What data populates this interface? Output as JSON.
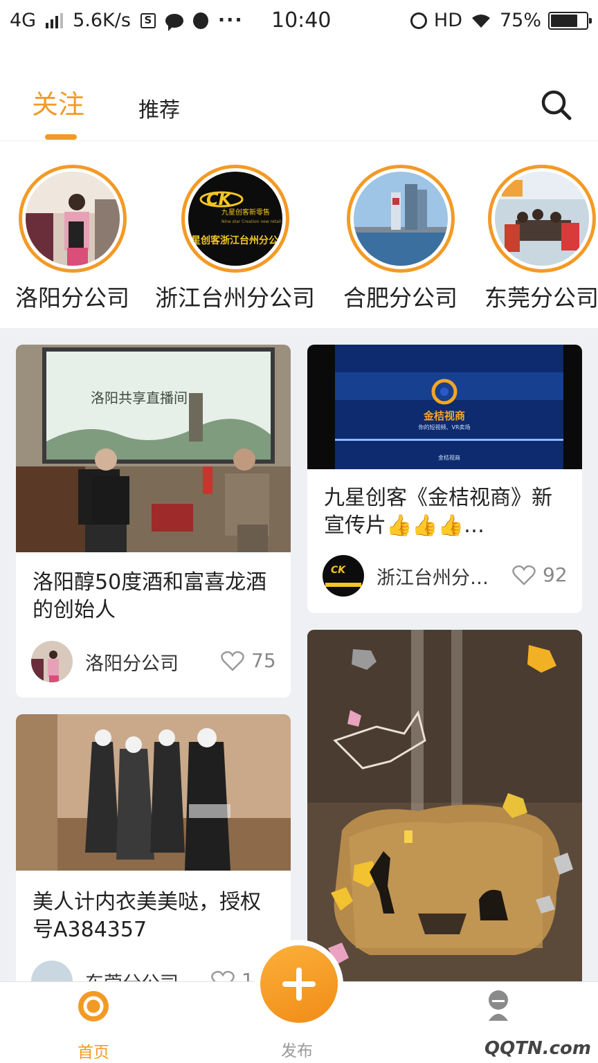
{
  "status_bar": {
    "network": "4G",
    "speed": "5.6K/s",
    "time": "10:40",
    "hd": "HD",
    "battery": "75%",
    "battery_level": 0.75,
    "icons": [
      "signal-icon",
      "sim-icon",
      "chat-icon",
      "flame-icon",
      "more-icon",
      "alarm-icon",
      "wifi-icon",
      "battery-icon"
    ]
  },
  "header": {
    "tabs": [
      {
        "label": "关注",
        "active": true
      },
      {
        "label": "推荐",
        "active": false
      }
    ],
    "search_icon": "search-icon",
    "accent_color": "#f39a26"
  },
  "follows": [
    {
      "name": "洛阳分公司",
      "avatar": "luoyang-avatar"
    },
    {
      "name": "浙江台州分公司",
      "avatar": "ck-logo-avatar"
    },
    {
      "name": "合肥分公司",
      "avatar": "hefei-avatar"
    },
    {
      "name": "东莞分公司",
      "avatar": "dongguan-avatar"
    }
  ],
  "feed": {
    "cards": [
      {
        "title": "洛阳醇50度酒和富喜龙酒的创始人",
        "author": "洛阳分公司",
        "likes": "75"
      },
      {
        "title": "九星创客《金桔视商》新宣传片👍👍👍…",
        "author": "浙江台州分…",
        "likes": "92"
      },
      {
        "title": "美人计内衣美美哒，授权号A384357",
        "author": "东莞分公司",
        "likes": "1"
      },
      {
        "title": "",
        "author": "",
        "likes": ""
      }
    ],
    "media_text": {
      "banner_text": "洛阳共享直播间",
      "logo_text": "金桔视商",
      "logo_sub": "你的短视频、VR卖场",
      "logo_foot": "金桔视商",
      "ck_logo_title": "九星创客新零售",
      "ck_logo_sub": "Nine star Creation new retail",
      "ck_logo_bottom": "星创客浙江台州分公"
    }
  },
  "bottom_nav": {
    "items": [
      {
        "label": "首页",
        "icon": "home-icon",
        "active": true
      },
      {
        "label": "发布",
        "icon": "plus-icon",
        "active": false
      },
      {
        "label": "",
        "icon": "profile-icon",
        "active": false
      }
    ]
  },
  "watermark": "QQTN.com"
}
